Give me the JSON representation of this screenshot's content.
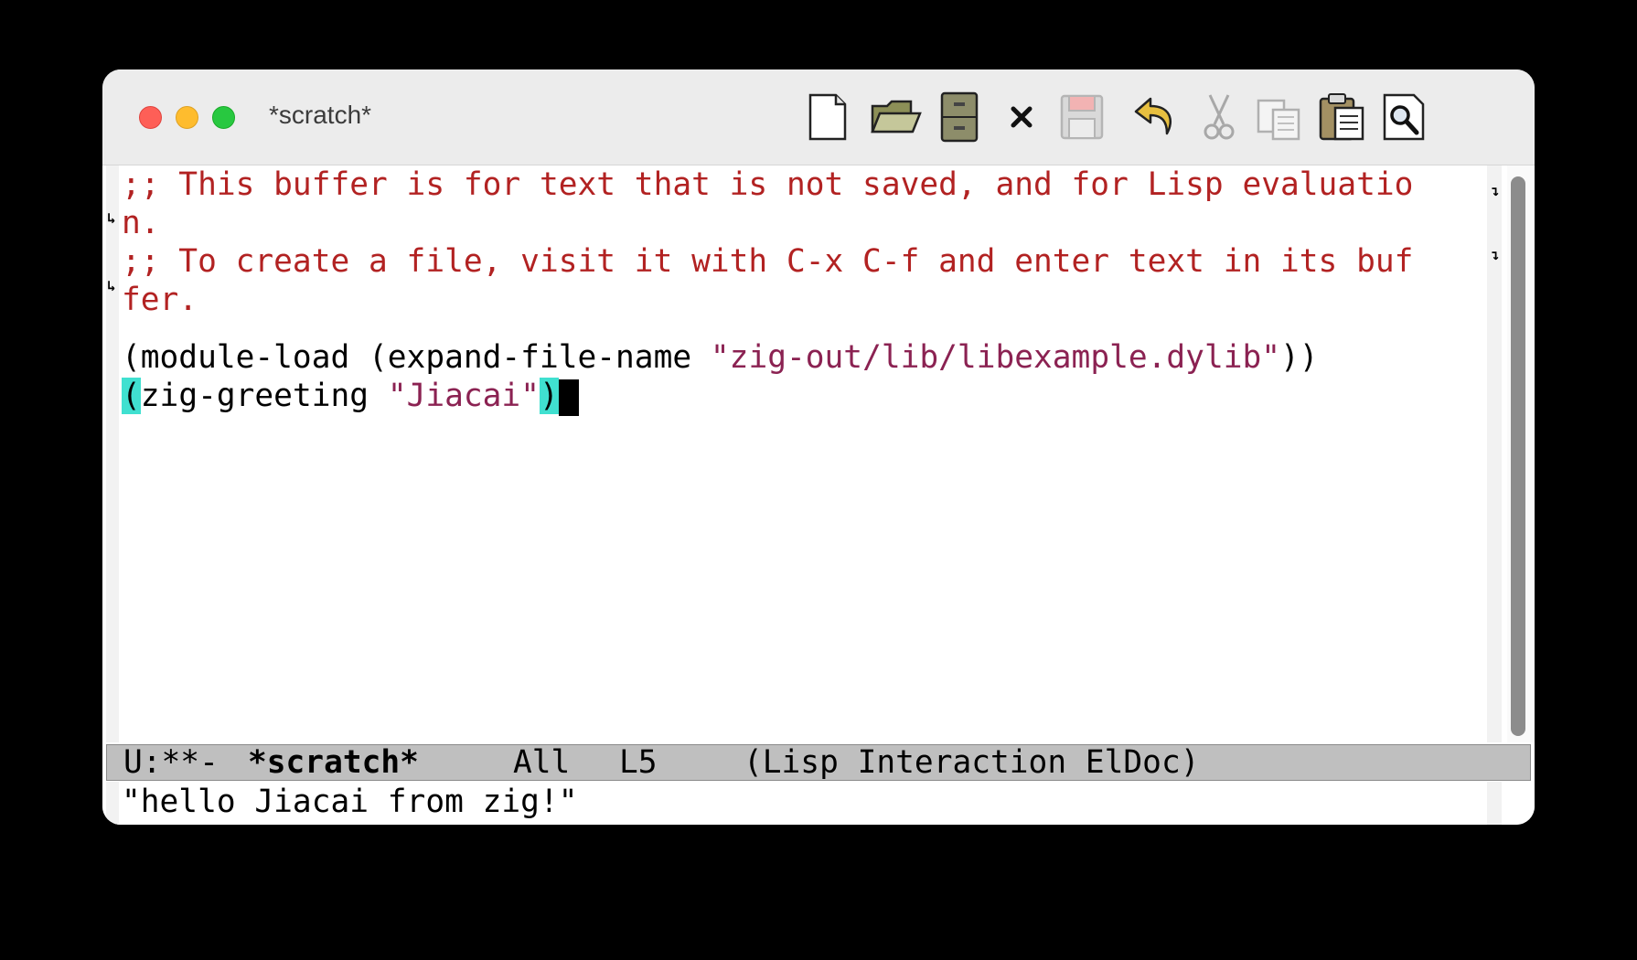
{
  "window": {
    "title": "*scratch*"
  },
  "toolbar": {
    "items": [
      {
        "name": "new-file",
        "icon": "new-file-icon",
        "enabled": true
      },
      {
        "name": "open-file",
        "icon": "open-folder-icon",
        "enabled": true
      },
      {
        "name": "dired",
        "icon": "file-cabinet-icon",
        "enabled": true
      },
      {
        "name": "kill-buffer",
        "icon": "close-x-icon",
        "enabled": true
      },
      {
        "name": "save",
        "icon": "floppy-disk-icon",
        "enabled": false
      },
      {
        "name": "undo",
        "icon": "undo-arrow-icon",
        "enabled": true
      },
      {
        "name": "cut",
        "icon": "scissors-icon",
        "enabled": false
      },
      {
        "name": "copy",
        "icon": "copy-icon",
        "enabled": false
      },
      {
        "name": "paste",
        "icon": "clipboard-icon",
        "enabled": true
      },
      {
        "name": "search",
        "icon": "magnifier-icon",
        "enabled": true
      }
    ]
  },
  "buffer": {
    "comment1_part1": ";; This buffer is for text that is not saved, and for Lisp evaluatio",
    "comment1_part2": "n.",
    "comment2_part1": ";; To create a file, visit it with C-x C-f and enter text in its buf",
    "comment2_part2": "fer.",
    "line5_a": "(module-load (expand-file-name ",
    "line5_str": "\"zig-out/lib/libexample.dylib\"",
    "line5_b": "))",
    "line6_open": "(",
    "line6_a": "zig-greeting ",
    "line6_str": "\"Jiacai\"",
    "line6_close": ")"
  },
  "modeline": {
    "status": "U:**-",
    "buffer_name": "*scratch*",
    "position": "All",
    "line": "L5",
    "modes": "(Lisp Interaction ElDoc)"
  },
  "minibuffer": {
    "message": "\"hello Jiacai from zig!\""
  },
  "colors": {
    "comment": "#b22222",
    "string": "#8b2252",
    "paren_match": "#40e0d0",
    "modeline_bg": "#bfbfbf"
  }
}
